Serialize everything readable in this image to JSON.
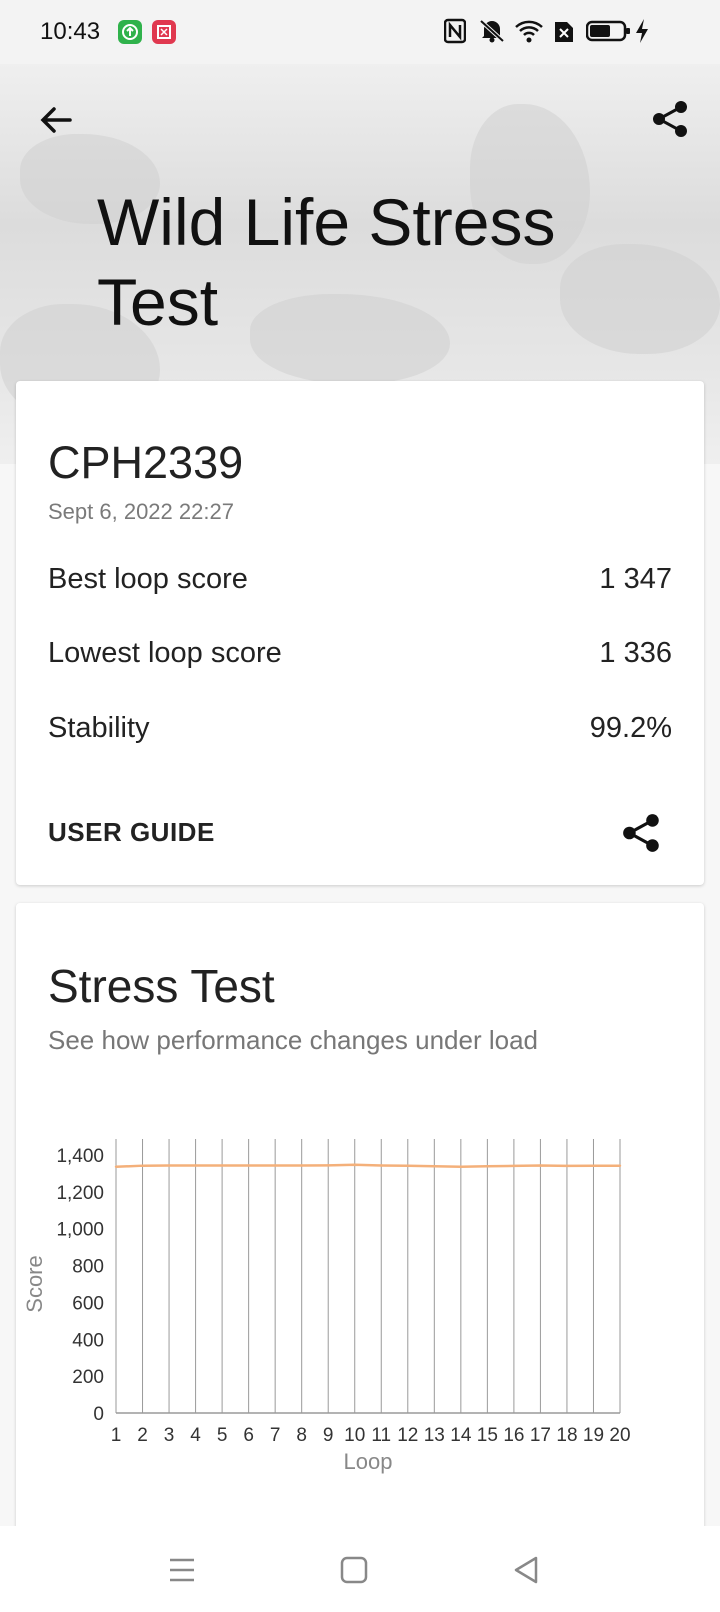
{
  "status_bar": {
    "time": "10:43"
  },
  "header": {
    "title": "Wild Life Stress Test"
  },
  "result": {
    "device": "CPH2339",
    "date": "Sept 6, 2022 22:27",
    "rows": [
      {
        "label": "Best loop score",
        "value": "1 347"
      },
      {
        "label": "Lowest loop score",
        "value": "1 336"
      },
      {
        "label": "Stability",
        "value": "99.2%"
      }
    ],
    "user_guide": "USER GUIDE"
  },
  "stress": {
    "title": "Stress Test",
    "subtitle": "See how performance changes under load"
  },
  "chart_data": {
    "type": "line",
    "title": "",
    "xlabel": "Loop",
    "ylabel": "Score",
    "x": [
      1,
      2,
      3,
      4,
      5,
      6,
      7,
      8,
      9,
      10,
      11,
      12,
      13,
      14,
      15,
      16,
      17,
      18,
      19,
      20
    ],
    "series": [
      {
        "values": [
          1336,
          1342,
          1343,
          1343,
          1343,
          1343,
          1343,
          1343,
          1344,
          1347,
          1343,
          1342,
          1339,
          1336,
          1339,
          1341,
          1343,
          1341,
          1342,
          1342
        ],
        "color": "#f4b07a"
      }
    ],
    "ylim": [
      0,
      1400
    ],
    "yticks": [
      0,
      200,
      400,
      600,
      800,
      1000,
      1200,
      1400
    ],
    "ytick_labels": [
      "0",
      "200",
      "400",
      "600",
      "800",
      "1,000",
      "1,200",
      "1,400"
    ],
    "grid": "vertical lines at each loop"
  },
  "colors": {
    "accent_line": "#f4b07a",
    "grid": "#9a9a9a"
  },
  "icons": [
    "back-arrow-icon",
    "share-icon",
    "nav-menu-icon",
    "nav-home-icon",
    "nav-back-icon"
  ]
}
